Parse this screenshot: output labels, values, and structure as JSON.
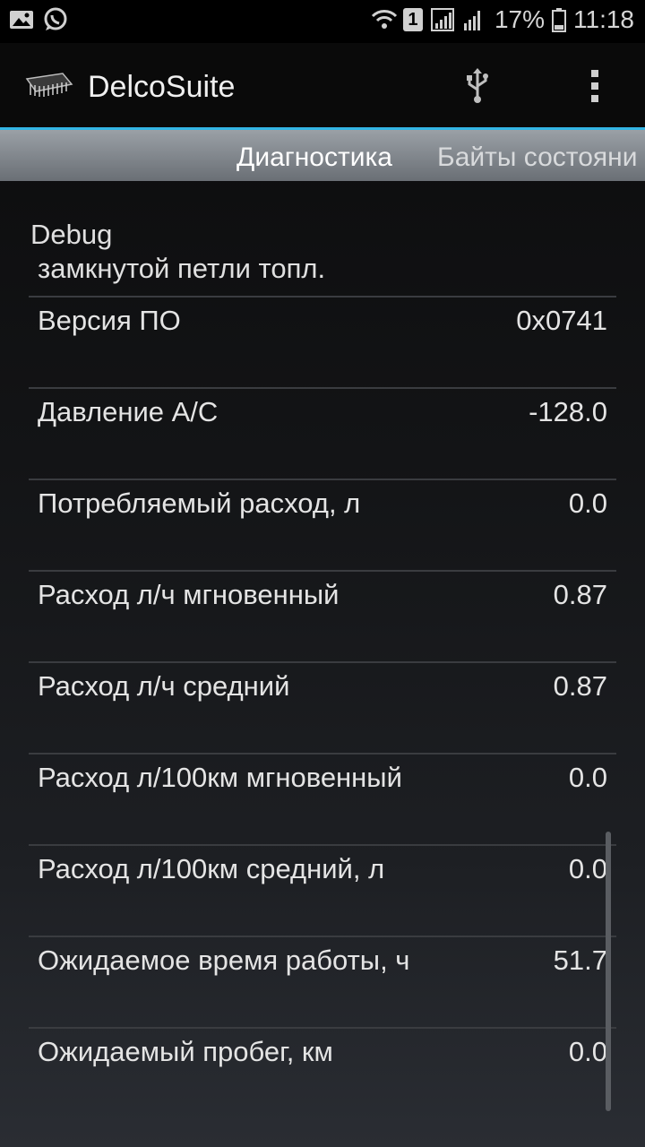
{
  "status_bar": {
    "battery": "17%",
    "time": "11:18",
    "sim_slot": "1",
    "icons": [
      "image-icon",
      "whatsapp-icon",
      "wifi-icon",
      "sim-badge-icon",
      "signal-icon",
      "signal-2-icon",
      "battery-icon"
    ]
  },
  "action_bar": {
    "title": "DelcoSuite",
    "icons": [
      "chip-app-icon",
      "usb-icon",
      "overflow-menu-icon"
    ]
  },
  "tabs": [
    {
      "label": "Диагностика",
      "active": true
    },
    {
      "label": "Байты состояни",
      "active": false
    }
  ],
  "content": {
    "debug_title": "Debug",
    "debug_subtitle": "замкнутой петли топл.",
    "rows": [
      {
        "label": "Версия ПО",
        "value": "0x0741"
      },
      {
        "label": "Давление А/С",
        "value": "-128.0"
      },
      {
        "label": "Потребляемый расход, л",
        "value": "0.0"
      },
      {
        "label": "Расход л/ч мгновенный",
        "value": "0.87"
      },
      {
        "label": "Расход л/ч средний",
        "value": "0.87"
      },
      {
        "label": "Расход л/100км мгновенный",
        "value": "0.0"
      },
      {
        "label": "Расход л/100км средний, л",
        "value": "0.0"
      },
      {
        "label": "Ожидаемое время работы, ч",
        "value": "51.7"
      },
      {
        "label": "Ожидаемый пробег, км",
        "value": "0.0"
      }
    ]
  },
  "colors": {
    "accent": "#33b5e5",
    "background": "#131416",
    "tab_strip": "#7d8288"
  }
}
